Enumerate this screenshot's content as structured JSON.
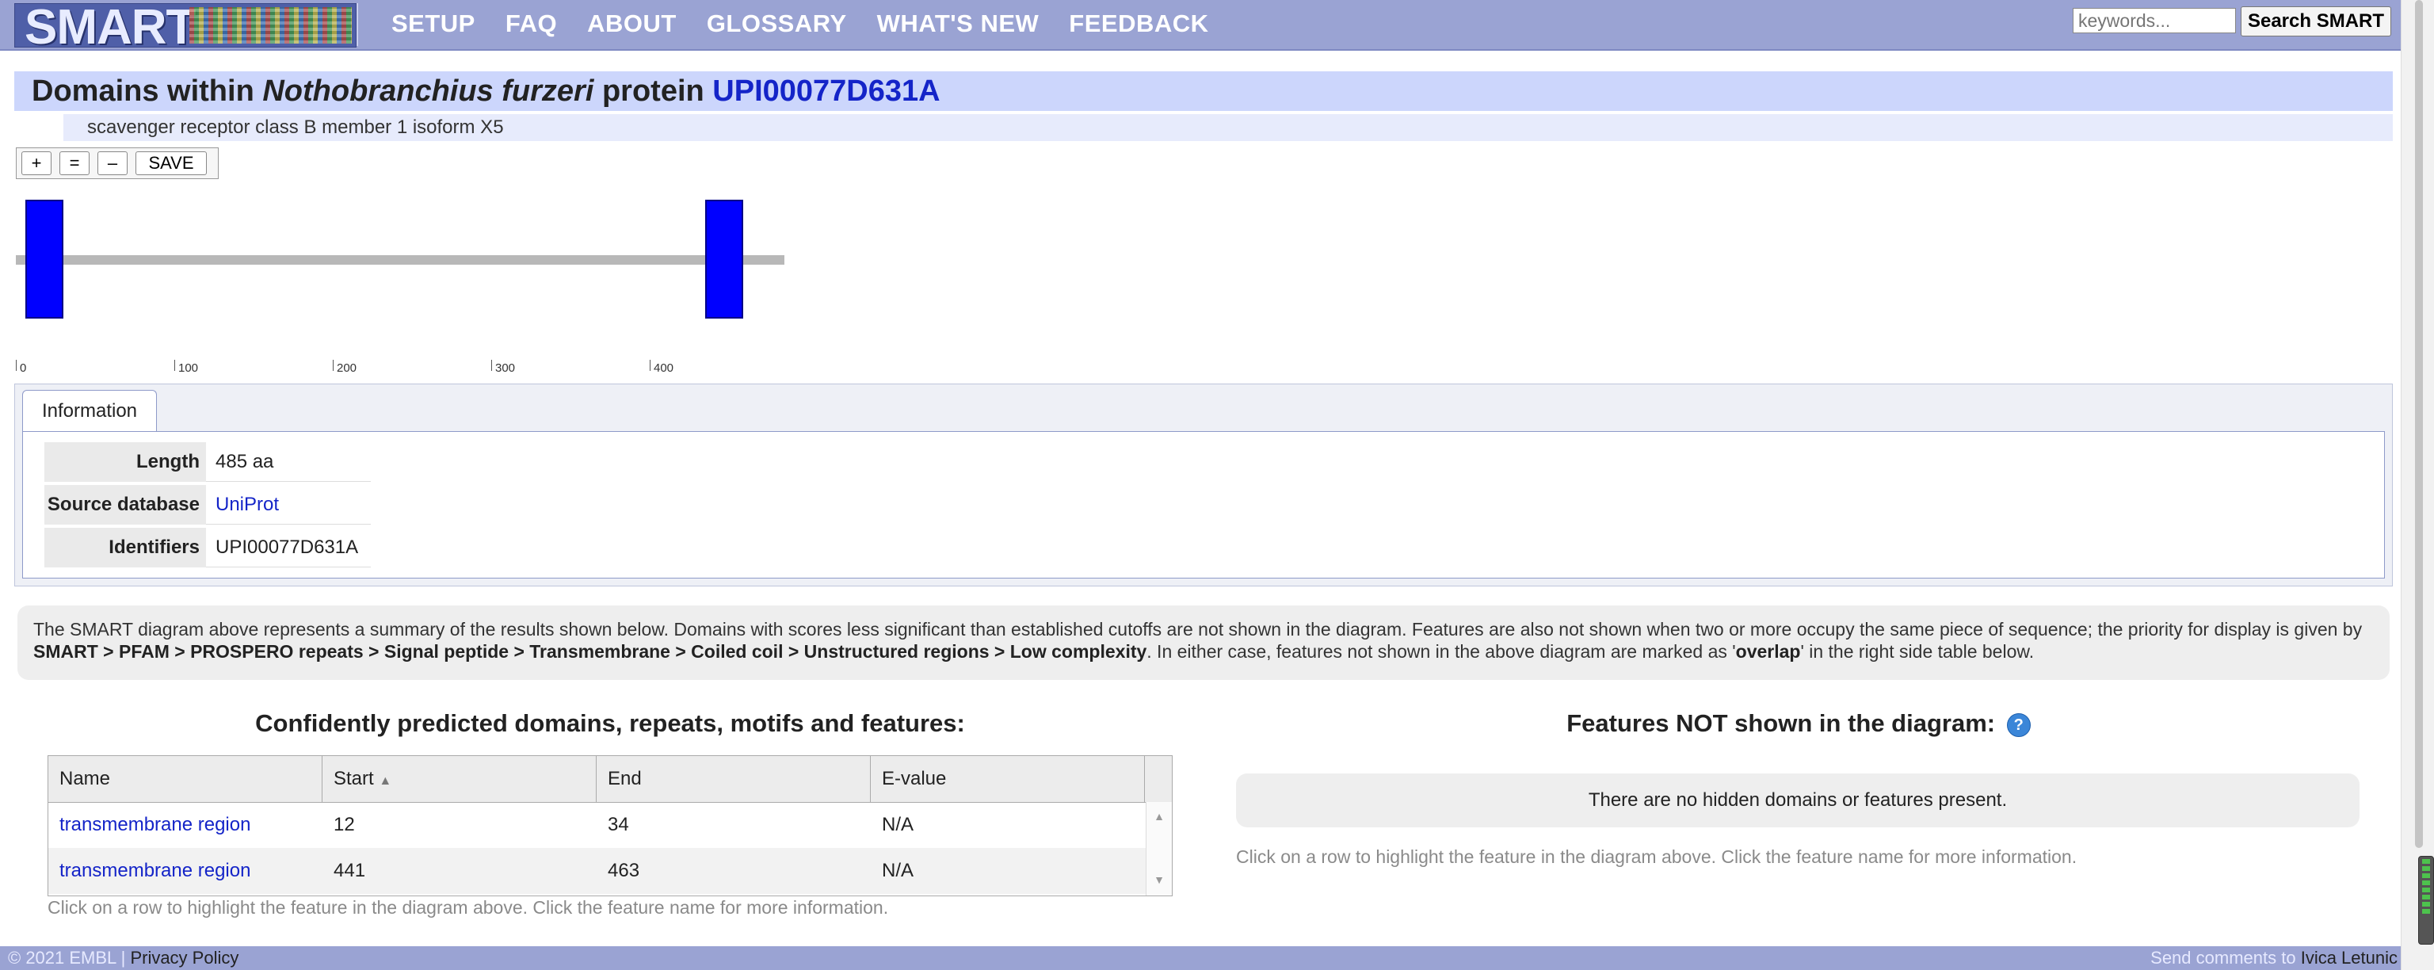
{
  "header": {
    "logo_text": "SMART",
    "nav": [
      "SETUP",
      "FAQ",
      "ABOUT",
      "GLOSSARY",
      "WHAT'S NEW",
      "FEEDBACK"
    ],
    "search": {
      "placeholder": "keywords...",
      "button_label": "Search SMART"
    }
  },
  "title": {
    "prefix": "Domains within",
    "species": "Nothobranchius furzeri",
    "middle": "protein",
    "accession": "UPI00077D631A"
  },
  "subtitle": "scavenger receptor class B member 1 isoform X5",
  "zoom_buttons": [
    "+",
    "=",
    "–",
    "SAVE"
  ],
  "diagram": {
    "length": 485,
    "domains": [
      {
        "name": "transmembrane region",
        "start": 12,
        "end": 34,
        "color": "#0000ff"
      },
      {
        "name": "transmembrane region",
        "start": 441,
        "end": 463,
        "color": "#0000ff"
      }
    ],
    "ticks": [
      "0",
      "100",
      "200",
      "300",
      "400"
    ]
  },
  "info": {
    "tab_label": "Information",
    "rows": [
      {
        "key": "Length",
        "value": "485 aa"
      },
      {
        "key": "Source database",
        "value": "UniProt"
      },
      {
        "key": "Identifiers",
        "value": "UPI00077D631A"
      }
    ]
  },
  "summary": {
    "part1": "The SMART diagram above represents a summary of the results shown below. Domains with scores less significant than established cutoffs are not shown in the diagram. Features are also not shown when two or more occupy the same piece of sequence; the priority for display is given by ",
    "priority": "SMART > PFAM > PROSPERO repeats > Signal peptide > Transmembrane > Coiled coil > Unstructured regions > Low complexity",
    "part2": ". In either case, features not shown in the above diagram are marked as '",
    "overlap": "overlap",
    "part3": "' in the right side table below."
  },
  "domains_table": {
    "title": "Confidently predicted domains, repeats, motifs and features:",
    "columns": [
      "Name",
      "Start",
      "End",
      "E-value"
    ],
    "sort_indicator": "▲",
    "rows": [
      {
        "name": "transmembrane region",
        "start": "12",
        "end": "34",
        "evalue": "N/A"
      },
      {
        "name": "transmembrane region",
        "start": "441",
        "end": "463",
        "evalue": "N/A"
      }
    ],
    "hint": "Click on a row to highlight the feature in the diagram above. Click the feature name for more information."
  },
  "hidden_features": {
    "title": "Features NOT shown in the diagram:",
    "help": "?",
    "empty_message": "There are no hidden domains or features present.",
    "hint": "Click on a row to highlight the feature in the diagram above. Click the feature name for more information."
  },
  "footer": {
    "copyright": "© 2021 EMBL",
    "separator": "|",
    "privacy": "Privacy Policy",
    "comments_prefix": "Send comments to",
    "author": "Ivica Letunic"
  },
  "colors": {
    "header": "#9aa3d3",
    "title_bg": "#ccd6fc",
    "domain": "#0000ff",
    "link": "#1424c8"
  }
}
